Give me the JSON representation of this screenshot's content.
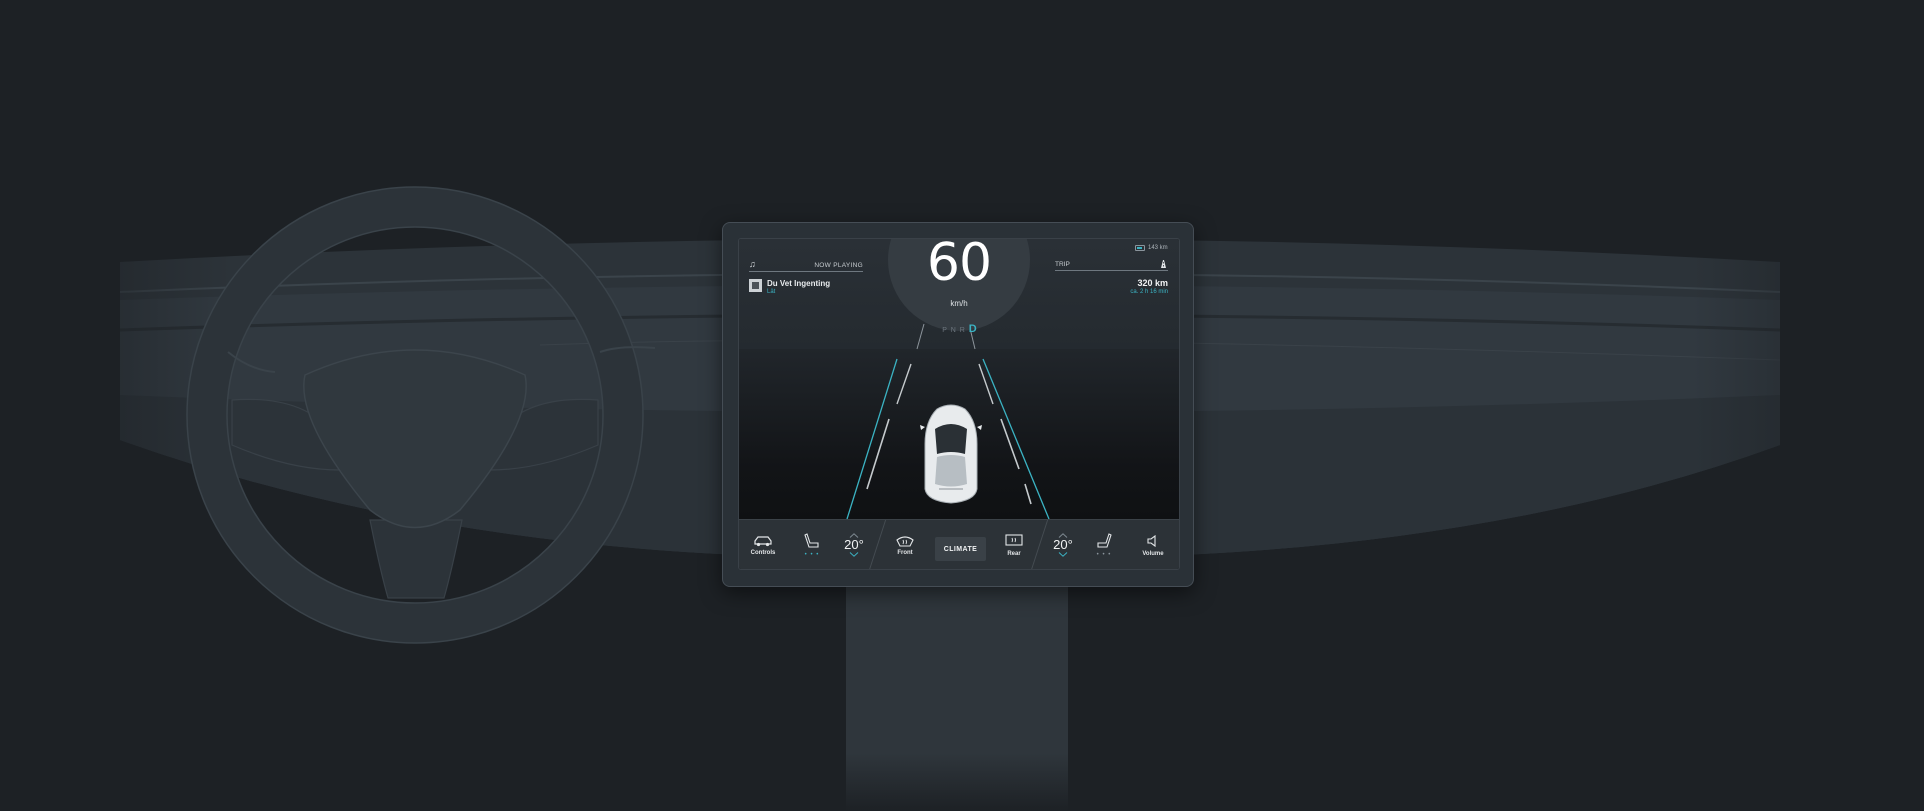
{
  "status": {
    "range": "143 km"
  },
  "speed": {
    "value": "60",
    "unit": "km/h"
  },
  "gears": {
    "p": "P",
    "n": "N",
    "r": "R",
    "d": "D",
    "active": "D"
  },
  "now_playing": {
    "label": "NOW PLAYING",
    "title": "Du Vet Ingenting",
    "artist": "Lät"
  },
  "trip": {
    "label": "TRIP",
    "distance": "320 km",
    "eta": "ca. 2 h 16 min"
  },
  "bottom_bar": {
    "controls": "Controls",
    "left_temp": "20°",
    "front": "Front",
    "climate": "CLIMATE",
    "rear": "Rear",
    "right_temp": "20°",
    "volume": "Volume",
    "seat_dots": "• • •"
  },
  "colors": {
    "background": "#1d2125",
    "accent": "#3bb3c3",
    "dashboard": "#2f363c"
  }
}
